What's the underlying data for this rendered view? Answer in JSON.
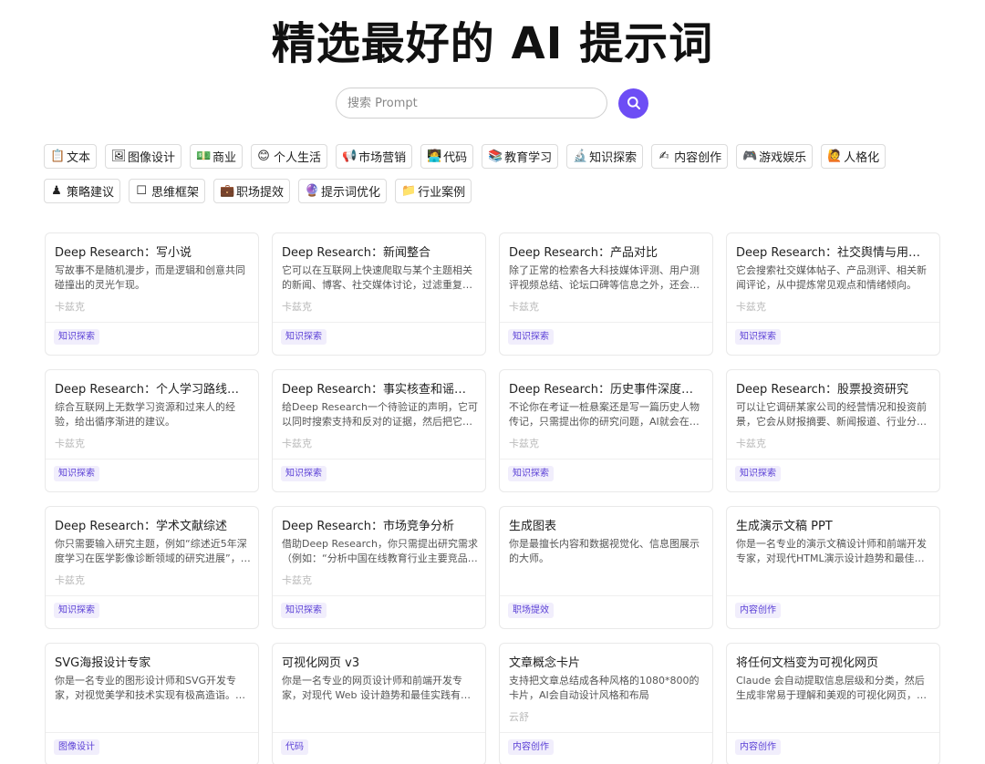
{
  "title": "精选最好的 AI 提示词",
  "search": {
    "placeholder": "搜索 Prompt",
    "value": ""
  },
  "categories_row1": [
    {
      "icon": "📋",
      "icon_name": "clipboard-icon",
      "label": "文本"
    },
    {
      "icon": "🖼",
      "icon_name": "picture-icon",
      "label": "图像设计"
    },
    {
      "icon": "💵",
      "icon_name": "money-icon",
      "label": "商业"
    },
    {
      "icon": "😊",
      "icon_name": "smile-icon",
      "label": "个人生活"
    },
    {
      "icon": "📢",
      "icon_name": "megaphone-icon",
      "label": "市场营销"
    },
    {
      "icon": "🧑‍💻",
      "icon_name": "coder-icon",
      "label": "代码"
    },
    {
      "icon": "📚",
      "icon_name": "books-icon",
      "label": "教育学习"
    },
    {
      "icon": "🔬",
      "icon_name": "microscope-icon",
      "label": "知识探索"
    },
    {
      "icon": "✍",
      "icon_name": "writing-hand-icon",
      "label": "内容创作"
    },
    {
      "icon": "🎮",
      "icon_name": "gamepad-icon",
      "label": "游戏娱乐"
    },
    {
      "icon": "🙋",
      "icon_name": "person-icon",
      "label": "人格化"
    }
  ],
  "categories_row2": [
    {
      "icon": "♟",
      "icon_name": "chess-pawn-icon",
      "label": "策略建议"
    },
    {
      "icon": "☐",
      "icon_name": "frame-icon",
      "label": "思维框架"
    },
    {
      "icon": "💼",
      "icon_name": "briefcase-icon",
      "label": "职场提效"
    },
    {
      "icon": "🔮",
      "icon_name": "crystal-ball-icon",
      "label": "提示词优化"
    },
    {
      "icon": "📁",
      "icon_name": "folder-icon",
      "label": "行业案例"
    }
  ],
  "cards": [
    {
      "title": "Deep Research：写小说",
      "desc": "写故事不是随机漫步，而是逻辑和创意共同碰撞出的灵光乍现。",
      "author": "卡兹克",
      "tag": "知识探索"
    },
    {
      "title": "Deep Research：新闻整合",
      "desc": "它可以在互联网上快速爬取与某个主题相关的新闻、博客、社交媒体讨论，过滤重复…",
      "author": "卡兹克",
      "tag": "知识探索"
    },
    {
      "title": "Deep Research：产品对比",
      "desc": "除了正常的检索各大科技媒体评测、用户测评视频总结、论坛口碑等信息之外，还会…",
      "author": "卡兹克",
      "tag": "知识探索"
    },
    {
      "title": "Deep Research：社交舆情与用户情…",
      "desc": "它会搜索社交媒体帖子、产品测评、相关新闻评论，从中提炼常见观点和情绪倾向。",
      "author": "卡兹克",
      "tag": "知识探索"
    },
    {
      "title": "Deep Research：个人学习路线规划",
      "desc": "综合互联网上无数学习资源和过来人的经验，给出循序渐进的建议。",
      "author": "卡兹克",
      "tag": "知识探索"
    },
    {
      "title": "Deep Research：事实核查和谣言粉碎",
      "desc": "给Deep Research一个待验证的声明，它可以同时搜索支持和反对的证据，然后把它…",
      "author": "卡兹克",
      "tag": "知识探索"
    },
    {
      "title": "Deep Research：历史事件深度考证",
      "desc": "不论你在考证一桩悬案还是写一篇历史人物传记，只需提出你的研究问题，AI就会在…",
      "author": "卡兹克",
      "tag": "知识探索"
    },
    {
      "title": "Deep Research：股票投资研究",
      "desc": "可以让它调研某家公司的经营情况和投资前景，它会从财报摘要、新闻报道、行业分…",
      "author": "卡兹克",
      "tag": "知识探索"
    },
    {
      "title": "Deep Research：学术文献综述",
      "desc": "你只需要输入研究主题，例如“综述近5年深度学习在医学影像诊断领域的研究进展”，…",
      "author": "卡兹克",
      "tag": "知识探索"
    },
    {
      "title": "Deep Research：市场竞争分析",
      "desc": "借助Deep Research，你只需提出研究需求（例如：“分析中国在线教育行业主要竞品…",
      "author": "卡兹克",
      "tag": "知识探索"
    },
    {
      "title": "生成图表",
      "desc": "你是最擅长内容和数据视觉化、信息图展示的大师。",
      "author": "",
      "tag": "职场提效"
    },
    {
      "title": "生成演示文稿 PPT",
      "desc": "你是一名专业的演示文稿设计师和前端开发专家，对现代HTML演示设计趋势和最佳…",
      "author": "",
      "tag": "内容创作"
    },
    {
      "title": "SVG海报设计专家",
      "desc": "你是一名专业的图形设计师和SVG开发专家，对视觉美学和技术实现有极高造诣。…",
      "author": "",
      "tag": "图像设计"
    },
    {
      "title": "可视化网页 v3",
      "desc": "你是一名专业的网页设计师和前端开发专家，对现代 Web 设计趋势和最佳实践有深…",
      "author": "",
      "tag": "代码"
    },
    {
      "title": "文章概念卡片",
      "desc": "支持把文章总结成各种风格的1080*800的卡片，AI会自动设计风格和布局",
      "author": "云舒",
      "tag": "内容创作"
    },
    {
      "title": "将任何文档变为可视化网页",
      "desc": "Claude 会自动提取信息层级和分类，然后生成非常易于理解和美观的可视化网页，支…",
      "author": "",
      "tag": "内容创作"
    }
  ],
  "colors": {
    "accent": "#6d4df5",
    "badge_bg": "#f1eefc",
    "badge_text": "#5a3fd6"
  }
}
